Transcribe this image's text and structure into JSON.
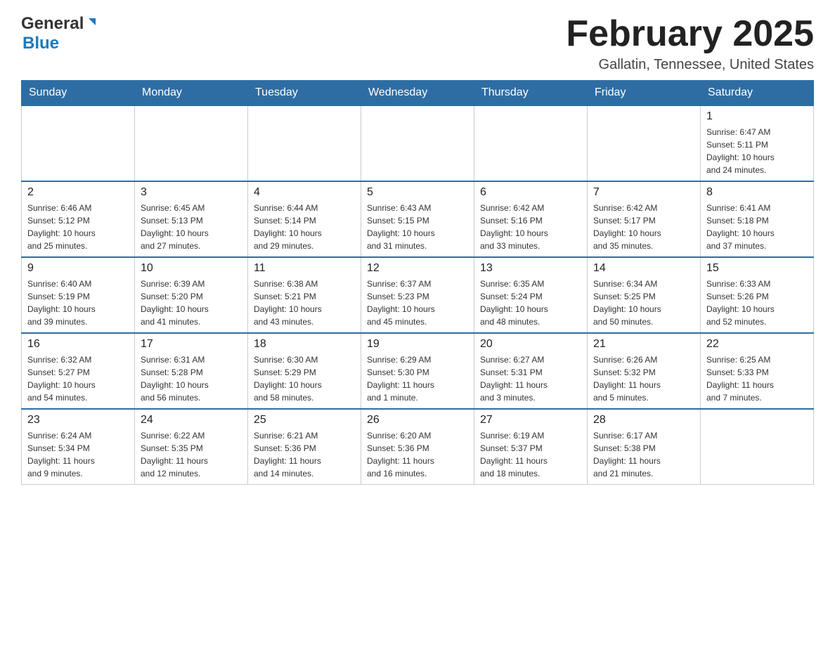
{
  "logo": {
    "general": "General",
    "blue": "Blue",
    "tagline": ""
  },
  "title": "February 2025",
  "location": "Gallatin, Tennessee, United States",
  "days_of_week": [
    "Sunday",
    "Monday",
    "Tuesday",
    "Wednesday",
    "Thursday",
    "Friday",
    "Saturday"
  ],
  "weeks": [
    [
      {
        "day": "",
        "info": ""
      },
      {
        "day": "",
        "info": ""
      },
      {
        "day": "",
        "info": ""
      },
      {
        "day": "",
        "info": ""
      },
      {
        "day": "",
        "info": ""
      },
      {
        "day": "",
        "info": ""
      },
      {
        "day": "1",
        "info": "Sunrise: 6:47 AM\nSunset: 5:11 PM\nDaylight: 10 hours\nand 24 minutes."
      }
    ],
    [
      {
        "day": "2",
        "info": "Sunrise: 6:46 AM\nSunset: 5:12 PM\nDaylight: 10 hours\nand 25 minutes."
      },
      {
        "day": "3",
        "info": "Sunrise: 6:45 AM\nSunset: 5:13 PM\nDaylight: 10 hours\nand 27 minutes."
      },
      {
        "day": "4",
        "info": "Sunrise: 6:44 AM\nSunset: 5:14 PM\nDaylight: 10 hours\nand 29 minutes."
      },
      {
        "day": "5",
        "info": "Sunrise: 6:43 AM\nSunset: 5:15 PM\nDaylight: 10 hours\nand 31 minutes."
      },
      {
        "day": "6",
        "info": "Sunrise: 6:42 AM\nSunset: 5:16 PM\nDaylight: 10 hours\nand 33 minutes."
      },
      {
        "day": "7",
        "info": "Sunrise: 6:42 AM\nSunset: 5:17 PM\nDaylight: 10 hours\nand 35 minutes."
      },
      {
        "day": "8",
        "info": "Sunrise: 6:41 AM\nSunset: 5:18 PM\nDaylight: 10 hours\nand 37 minutes."
      }
    ],
    [
      {
        "day": "9",
        "info": "Sunrise: 6:40 AM\nSunset: 5:19 PM\nDaylight: 10 hours\nand 39 minutes."
      },
      {
        "day": "10",
        "info": "Sunrise: 6:39 AM\nSunset: 5:20 PM\nDaylight: 10 hours\nand 41 minutes."
      },
      {
        "day": "11",
        "info": "Sunrise: 6:38 AM\nSunset: 5:21 PM\nDaylight: 10 hours\nand 43 minutes."
      },
      {
        "day": "12",
        "info": "Sunrise: 6:37 AM\nSunset: 5:23 PM\nDaylight: 10 hours\nand 45 minutes."
      },
      {
        "day": "13",
        "info": "Sunrise: 6:35 AM\nSunset: 5:24 PM\nDaylight: 10 hours\nand 48 minutes."
      },
      {
        "day": "14",
        "info": "Sunrise: 6:34 AM\nSunset: 5:25 PM\nDaylight: 10 hours\nand 50 minutes."
      },
      {
        "day": "15",
        "info": "Sunrise: 6:33 AM\nSunset: 5:26 PM\nDaylight: 10 hours\nand 52 minutes."
      }
    ],
    [
      {
        "day": "16",
        "info": "Sunrise: 6:32 AM\nSunset: 5:27 PM\nDaylight: 10 hours\nand 54 minutes."
      },
      {
        "day": "17",
        "info": "Sunrise: 6:31 AM\nSunset: 5:28 PM\nDaylight: 10 hours\nand 56 minutes."
      },
      {
        "day": "18",
        "info": "Sunrise: 6:30 AM\nSunset: 5:29 PM\nDaylight: 10 hours\nand 58 minutes."
      },
      {
        "day": "19",
        "info": "Sunrise: 6:29 AM\nSunset: 5:30 PM\nDaylight: 11 hours\nand 1 minute."
      },
      {
        "day": "20",
        "info": "Sunrise: 6:27 AM\nSunset: 5:31 PM\nDaylight: 11 hours\nand 3 minutes."
      },
      {
        "day": "21",
        "info": "Sunrise: 6:26 AM\nSunset: 5:32 PM\nDaylight: 11 hours\nand 5 minutes."
      },
      {
        "day": "22",
        "info": "Sunrise: 6:25 AM\nSunset: 5:33 PM\nDaylight: 11 hours\nand 7 minutes."
      }
    ],
    [
      {
        "day": "23",
        "info": "Sunrise: 6:24 AM\nSunset: 5:34 PM\nDaylight: 11 hours\nand 9 minutes."
      },
      {
        "day": "24",
        "info": "Sunrise: 6:22 AM\nSunset: 5:35 PM\nDaylight: 11 hours\nand 12 minutes."
      },
      {
        "day": "25",
        "info": "Sunrise: 6:21 AM\nSunset: 5:36 PM\nDaylight: 11 hours\nand 14 minutes."
      },
      {
        "day": "26",
        "info": "Sunrise: 6:20 AM\nSunset: 5:36 PM\nDaylight: 11 hours\nand 16 minutes."
      },
      {
        "day": "27",
        "info": "Sunrise: 6:19 AM\nSunset: 5:37 PM\nDaylight: 11 hours\nand 18 minutes."
      },
      {
        "day": "28",
        "info": "Sunrise: 6:17 AM\nSunset: 5:38 PM\nDaylight: 11 hours\nand 21 minutes."
      },
      {
        "day": "",
        "info": ""
      }
    ]
  ]
}
